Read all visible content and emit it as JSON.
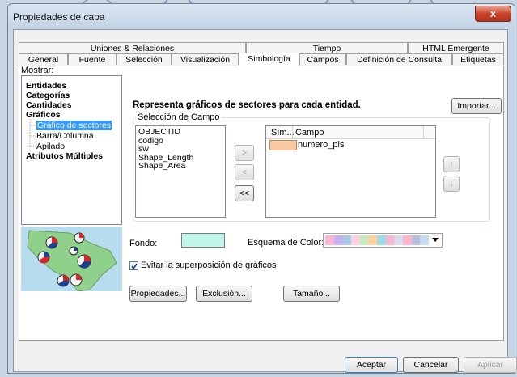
{
  "window": {
    "title": "Propiedades de capa",
    "close_glyph": "x"
  },
  "tabs_top": [
    "Uniones & Relaciones",
    "Tiempo",
    "HTML Emergente"
  ],
  "tabs_bottom": [
    "General",
    "Fuente",
    "Selección",
    "Visualización",
    "Simbología",
    "Campos",
    "Definición de Consulta",
    "Etiquetas"
  ],
  "active_tab": "Simbología",
  "show_label": "Mostrar:",
  "tree": {
    "items": [
      "Entidades",
      "Categorías",
      "Cantidades",
      "Gráficos",
      "Gráfico de sectores",
      "Barra/Columna",
      "Apilado",
      "Atributos Múltiples"
    ],
    "selected": "Gráfico de sectores"
  },
  "description": "Representa gráficos de sectores para cada entidad.",
  "import_button": "Importar...",
  "field_selection": {
    "label": "Selección de Campo",
    "fields": [
      "OBJECTID",
      "codigo",
      "sw",
      "Shape_Length",
      "Shape_Area"
    ],
    "add_button": ">",
    "remove_button": "<",
    "remove_all_button": "<<"
  },
  "symbol_table": {
    "headers": [
      "Sím...",
      "Campo"
    ],
    "rows": [
      {
        "symbol_color": "#f9c9a2",
        "field": "numero_pis"
      }
    ]
  },
  "move_up_glyph": "↑",
  "move_down_glyph": "↓",
  "background": {
    "label": "Fondo:",
    "color": "#c1f5ea"
  },
  "color_scheme": {
    "label": "Esquema de Color:",
    "colors": [
      "#f7b6d2",
      "#c5b0f5",
      "#aec7e8",
      "#ffd0e0",
      "#c7e9c0",
      "#fdd0a2",
      "#9edae5",
      "#f7b6d2",
      "#dadaeb",
      "#fbb4c9",
      "#bcbddc",
      "#c6dbef"
    ]
  },
  "avoid_overlap": {
    "label": "Evitar la superposición de gráficos",
    "checked": true
  },
  "buttons": {
    "properties": "Propiedades...",
    "exclusion": "Exclusión...",
    "size": "Tamaño..."
  },
  "footer": {
    "accept": "Aceptar",
    "cancel": "Cancelar",
    "apply": "Aplicar"
  },
  "colors": {
    "selection": "#3399ff",
    "titlebar": "#c3d4e6",
    "close": "#c7432a"
  }
}
